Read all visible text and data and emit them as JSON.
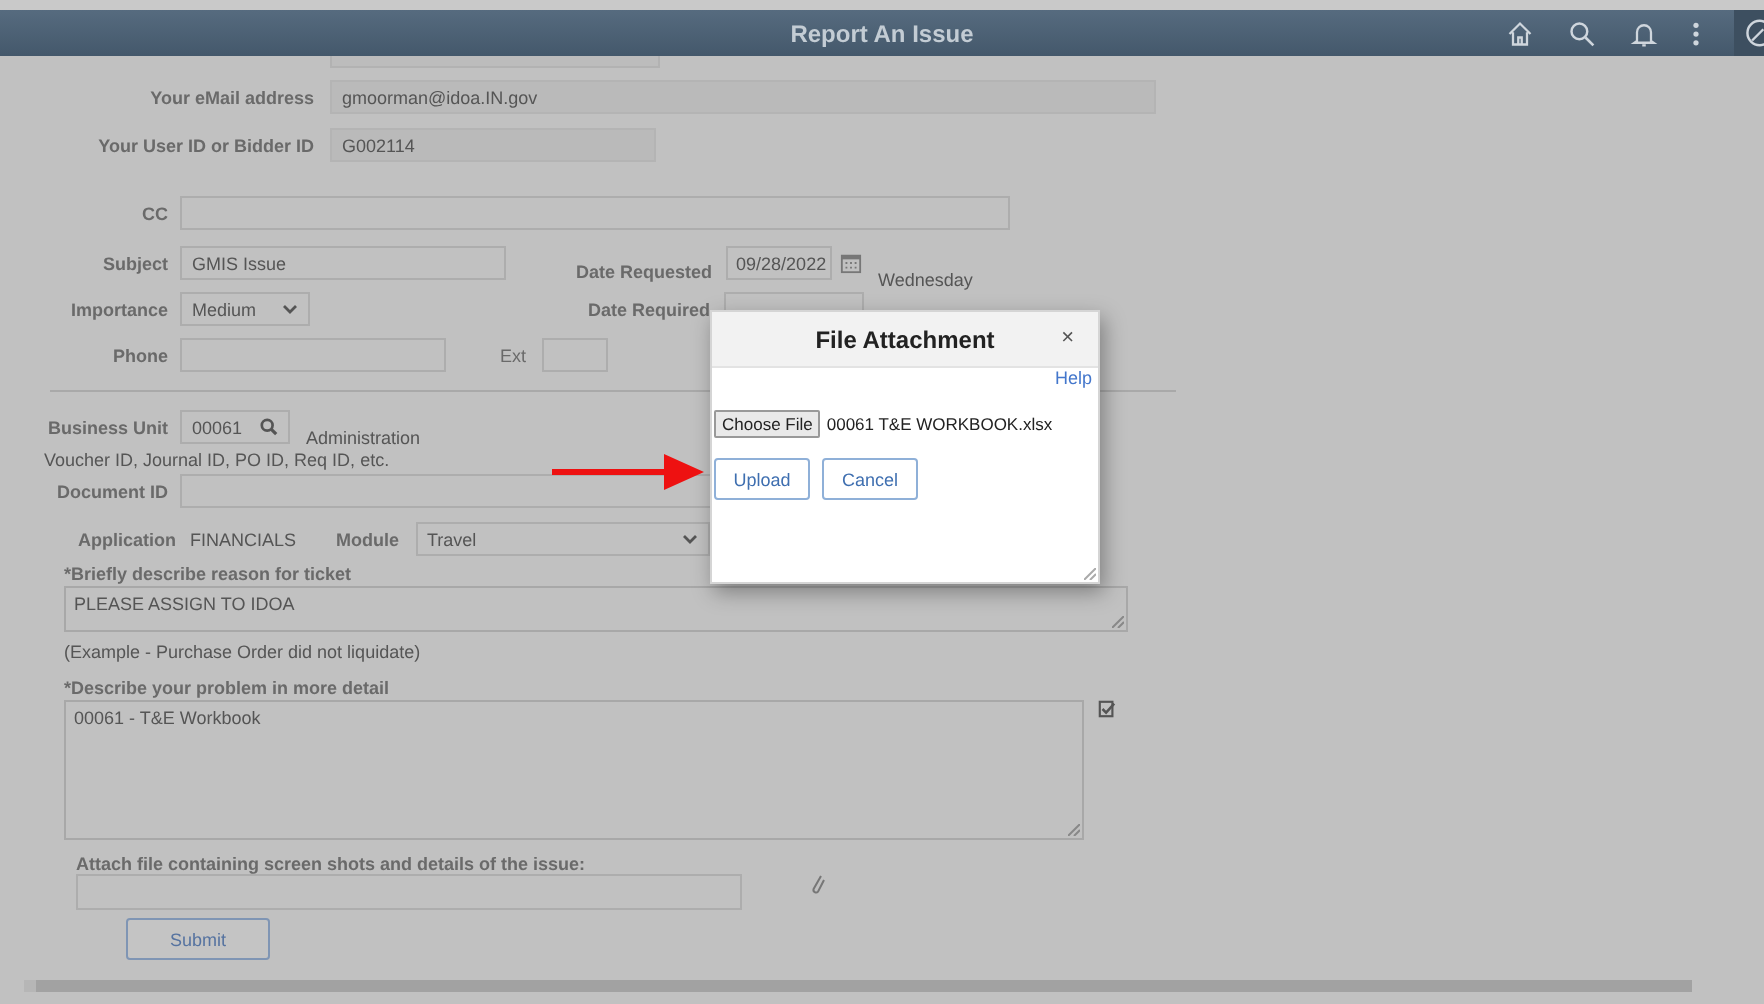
{
  "header": {
    "title": "Report An Issue"
  },
  "form": {
    "email": {
      "label": "Your eMail address",
      "value": "gmoorman@idoa.IN.gov"
    },
    "user_id": {
      "label": "Your User ID or Bidder ID",
      "value": "G002114"
    },
    "cc": {
      "label": "CC"
    },
    "subject": {
      "label": "Subject",
      "value": "GMIS Issue"
    },
    "date_requested": {
      "label": "Date Requested",
      "value": "09/28/2022",
      "weekday": "Wednesday"
    },
    "importance": {
      "label": "Importance",
      "value": "Medium"
    },
    "date_required": {
      "label": "Date Required"
    },
    "phone": {
      "label": "Phone"
    },
    "ext": {
      "label": "Ext"
    },
    "business_unit": {
      "label": "Business Unit",
      "value": "00061",
      "description": "Administration"
    },
    "document_id": {
      "hint": "Voucher ID, Journal ID, PO ID, Req ID, etc.",
      "label": "Document ID"
    },
    "application": {
      "label": "Application",
      "value": "FINANCIALS"
    },
    "module": {
      "label": "Module",
      "value": "Travel"
    },
    "reason": {
      "label": "*Briefly describe reason for ticket",
      "value": "PLEASE ASSIGN TO IDOA",
      "example": "(Example - Purchase Order did not liquidate)"
    },
    "detail": {
      "label": "*Describe your problem in more detail",
      "value": "00061 - T&E Workbook"
    },
    "attach": {
      "label": "Attach file containing screen shots and details of the issue:"
    },
    "submit": "Submit"
  },
  "dialog": {
    "title": "File Attachment",
    "close": "×",
    "help": "Help",
    "choose_file": "Choose File",
    "file_name": "00061 T&E WORKBOOK.xlsx",
    "buttons": [
      "Upload",
      "Cancel"
    ]
  }
}
